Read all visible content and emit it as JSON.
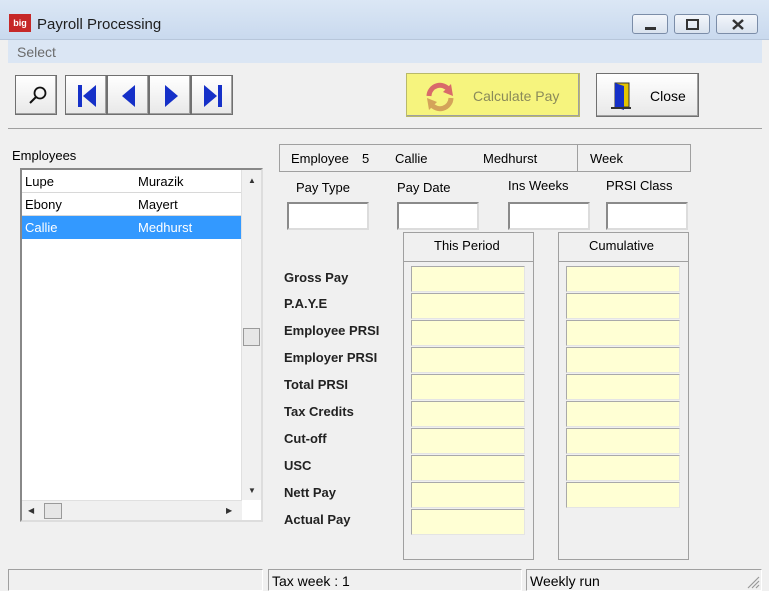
{
  "window": {
    "title": "Payroll Processing",
    "logo_text": "big"
  },
  "menu": {
    "select_label": "Select"
  },
  "toolbar": {
    "calculate_label": "Calculate Pay",
    "close_label": "Close"
  },
  "employees": {
    "label": "Employees",
    "rows": [
      {
        "first": "Lupe",
        "last": "Murazik",
        "selected": false
      },
      {
        "first": "Ebony",
        "last": "Mayert",
        "selected": false
      },
      {
        "first": "Callie",
        "last": "Medhurst",
        "selected": true
      }
    ]
  },
  "header": {
    "employee_label": "Employee",
    "employee_number": "5",
    "first_name": "Callie",
    "last_name": "Medhurst",
    "week_label": "Week"
  },
  "fields": {
    "pay_type_label": "Pay Type",
    "pay_date_label": "Pay Date",
    "ins_weeks_label": "Ins Weeks",
    "prsi_class_label": "PRSI Class",
    "pay_type_value": "",
    "pay_date_value": "",
    "ins_weeks_value": "",
    "prsi_class_value": ""
  },
  "columns": {
    "this_period": "This Period",
    "cumulative": "Cumulative"
  },
  "rows": [
    {
      "label": "Gross Pay"
    },
    {
      "label": "P.A.Y.E"
    },
    {
      "label": "Employee PRSI"
    },
    {
      "label": "Employer PRSI"
    },
    {
      "label": "Total PRSI"
    },
    {
      "label": "Tax Credits"
    },
    {
      "label": "Cut-off"
    },
    {
      "label": "USC"
    },
    {
      "label": "Nett Pay"
    },
    {
      "label": "Actual Pay"
    }
  ],
  "status": {
    "left": "",
    "tax_week": "Tax week : 1",
    "run_type": "Weekly run"
  },
  "colors": {
    "accent_selected": "#3399ff",
    "calculate_bg": "#f6f47e",
    "amount_bg": "#ffffd4"
  },
  "icons": [
    "search-icon",
    "first-record-icon",
    "prev-record-icon",
    "next-record-icon",
    "last-record-icon",
    "refresh-calc-icon",
    "exit-door-icon"
  ]
}
